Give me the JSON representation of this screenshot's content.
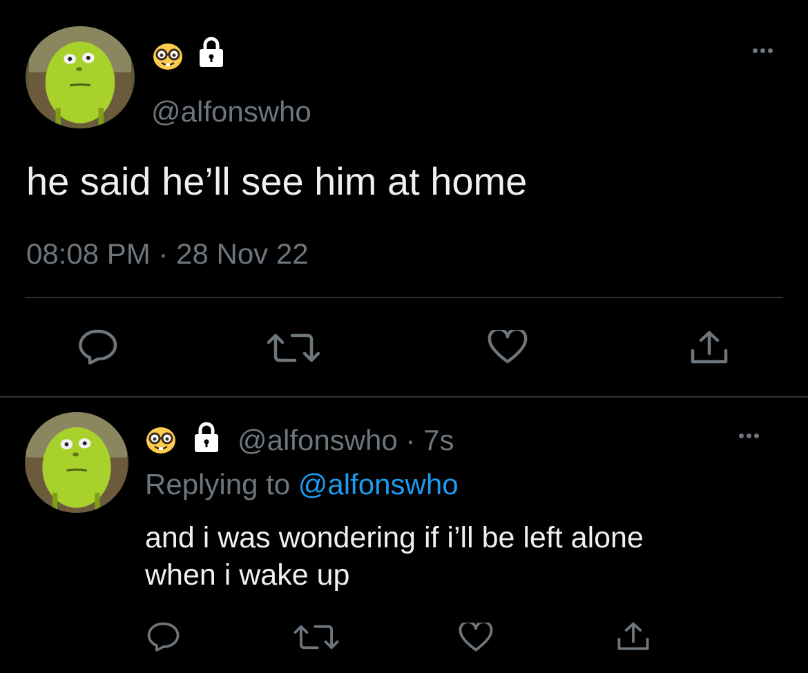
{
  "main_tweet": {
    "handle": "@alfonswho",
    "emoji_icon": "nerd-face-emoji",
    "lock_icon": "lock-icon",
    "text": "he said he’ll see him at home",
    "timestamp": "08:08 PM · 28 Nov 22",
    "actions": [
      "reply-icon",
      "retweet-icon",
      "like-icon",
      "share-icon"
    ]
  },
  "reply_tweet": {
    "handle_time": "@alfonswho · 7s",
    "replying_prefix": "Replying to",
    "replying_to": "@alfonswho",
    "text_line1": "and i was wondering if i’ll be left alone",
    "text_line2": "when i wake up",
    "actions": [
      "reply-icon",
      "retweet-icon",
      "like-icon",
      "share-icon"
    ]
  },
  "colors": {
    "background": "#000000",
    "text": "#e7e9ea",
    "muted": "#6e767d",
    "link": "#1d9bf0",
    "divider": "#2f3336"
  }
}
